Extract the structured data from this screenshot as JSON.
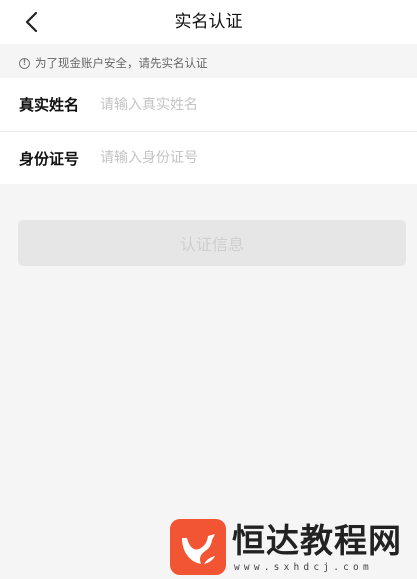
{
  "header": {
    "title": "实名认证",
    "back_icon": "chevron-left-icon"
  },
  "notice": {
    "icon": "exclamation-circle-icon",
    "text": "为了现金账户安全，请先实名认证"
  },
  "form": {
    "name_label": "真实姓名",
    "name_placeholder": "请输入真实姓名",
    "name_value": "",
    "id_label": "身份证号",
    "id_placeholder": "请输入身份证号",
    "id_value": ""
  },
  "submit": {
    "label": "认证信息",
    "enabled": false
  },
  "watermark": {
    "brand": "恒达教程网",
    "url": "www.sxhdcj.com",
    "logo_color": "#f25533"
  },
  "colors": {
    "background": "#f5f5f5",
    "surface": "#ffffff",
    "button_disabled": "#e6e6e6",
    "button_text_disabled": "#cfcfcf",
    "placeholder": "#c4c4c4"
  }
}
